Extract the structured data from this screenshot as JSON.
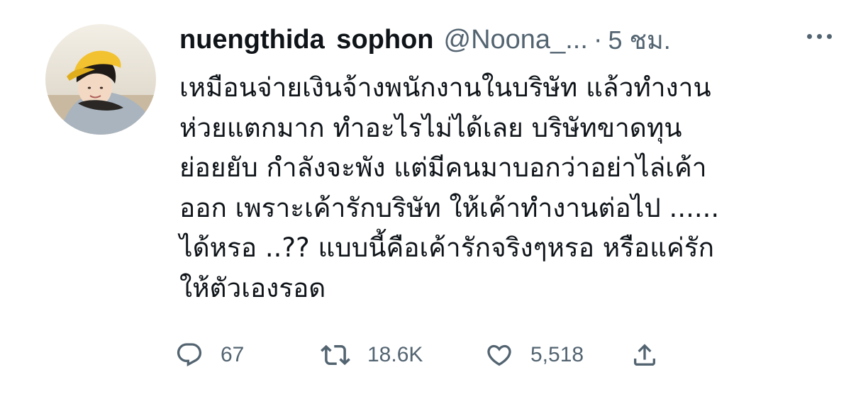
{
  "tweet": {
    "author_name": "nuengthida  sophon",
    "handle": "@Noona_...",
    "separator": "·",
    "time": "5 ชม.",
    "text_lines": [
      "เหมือนจ่ายเงินจ้างพนักงานในบริษัท แล้วทำงาน",
      "ห่วยแตกมาก ทำอะไรไม่ได้เลย บริษัทขาดทุน",
      "ย่อยยับ กำลังจะพัง แต่มีคนมาบอกว่าอย่าไล่เค้า",
      "ออก เพราะเค้ารักบริษัท ให้เค้าทำงานต่อไป ......",
      "ได้หรอ ..?? แบบนี้คือเค้ารักจริงๆหรอ หรือแค่รัก",
      "ให้ตัวเองรอด"
    ],
    "stats": {
      "replies": "67",
      "retweets": "18.6K",
      "likes": "5,518"
    }
  },
  "icons": {
    "more": "more-horizontal-icon",
    "reply": "reply-icon",
    "retweet": "retweet-icon",
    "like": "heart-icon",
    "share": "share-icon"
  },
  "colors": {
    "text": "#0f1419",
    "secondary": "#536471",
    "avatar_hat": "#f2c230",
    "avatar_jacket": "#a9b4bf"
  }
}
